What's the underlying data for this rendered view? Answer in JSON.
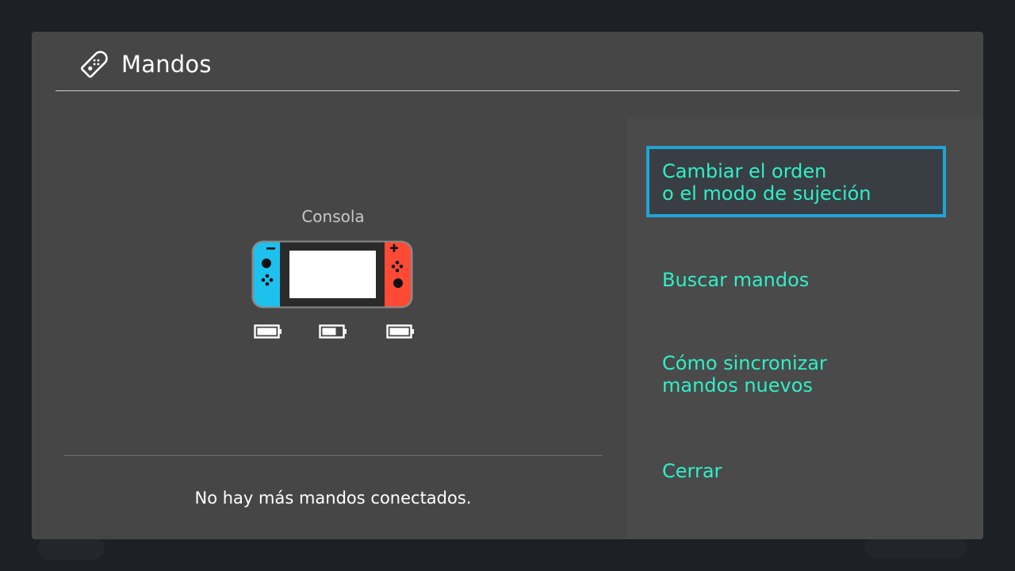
{
  "header": {
    "title": "Mandos",
    "icon": "joycon-icon"
  },
  "console": {
    "label": "Consola",
    "left_joycon_color": "#1ec0ee",
    "right_joycon_color": "#ff4a35",
    "battery_count": 3
  },
  "menu": {
    "items": [
      {
        "line1": "Cambiar el orden",
        "line2": "o el modo de sujeción",
        "selected": true
      },
      {
        "line1": "Buscar mandos",
        "line2": ""
      },
      {
        "line1": "Cómo sincronizar",
        "line2": "mandos nuevos"
      },
      {
        "line1": "Cerrar",
        "line2": ""
      }
    ]
  },
  "status": {
    "message": "No hay más mandos conectados."
  },
  "colors": {
    "accent_text": "#2ff0c8",
    "selection_border": "#22a3d6",
    "panel": "#464646"
  }
}
